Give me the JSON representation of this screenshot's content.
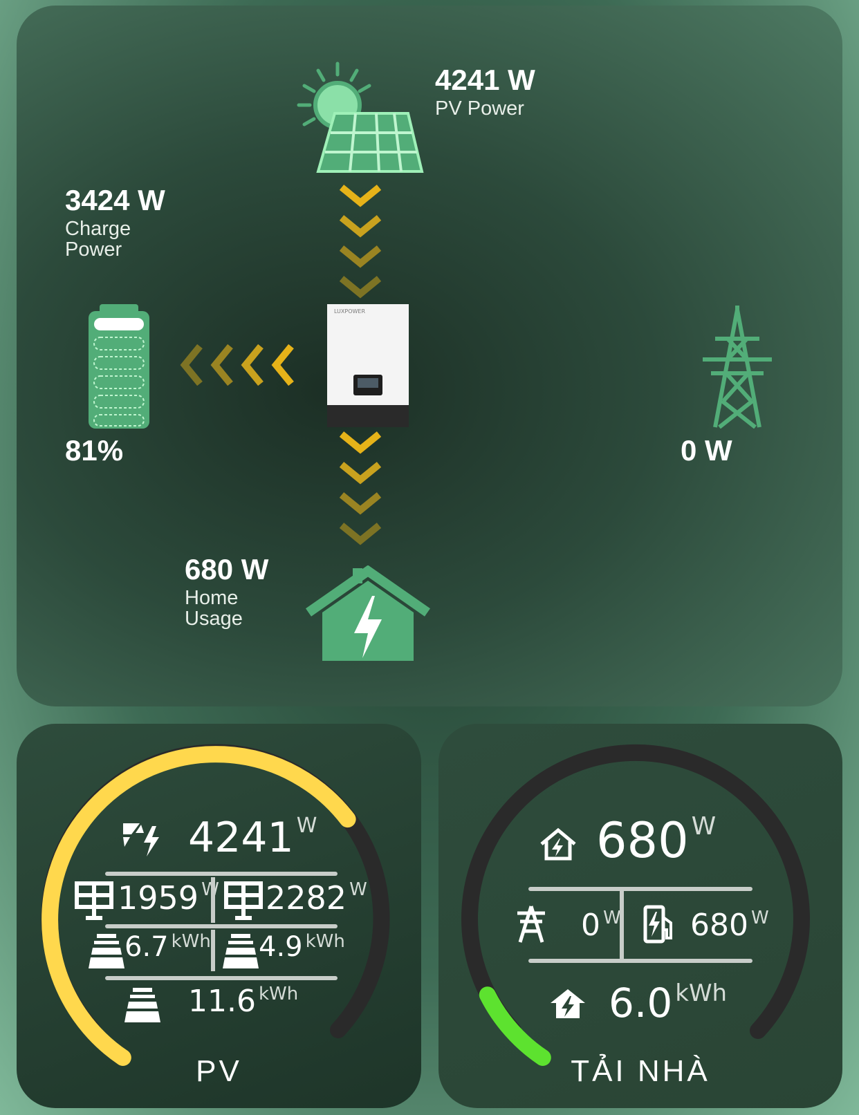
{
  "flow": {
    "pv": {
      "value": "4241 W",
      "label": "PV Power"
    },
    "charge": {
      "value": "3424 W",
      "label_line1": "Charge",
      "label_line2": "Power"
    },
    "battery": {
      "soc": "81%",
      "level_fraction": 0.81
    },
    "grid": {
      "value": "0 W"
    },
    "home": {
      "value": "680 W",
      "label_line1": "Home",
      "label_line2": "Usage"
    },
    "inverter": {
      "brand": "LUXPOWER"
    },
    "colors": {
      "arrow": "#e6b319",
      "icon_green": "#52ad78"
    }
  },
  "pv_card": {
    "title": "PV",
    "total_power": {
      "value": "4241",
      "unit": "W"
    },
    "string1_power": {
      "value": "1959",
      "unit": "W"
    },
    "string2_power": {
      "value": "2282",
      "unit": "W"
    },
    "string1_energy": {
      "value": "6.7",
      "unit": "kWh"
    },
    "string2_energy": {
      "value": "4.9",
      "unit": "kWh"
    },
    "total_energy": {
      "value": "11.6",
      "unit": "kWh"
    },
    "gauge_fraction": 0.68,
    "gauge_color": "#ffd84d"
  },
  "load_card": {
    "title": "TẢI NHÀ",
    "home_power": {
      "value": "680",
      "unit": "W"
    },
    "grid_power": {
      "value": "0",
      "unit": "W"
    },
    "ev_power": {
      "value": "680",
      "unit": "W"
    },
    "home_energy": {
      "value": "6.0",
      "unit": "kWh"
    },
    "gauge_fraction": 0.1,
    "gauge_color": "#5de22f"
  }
}
